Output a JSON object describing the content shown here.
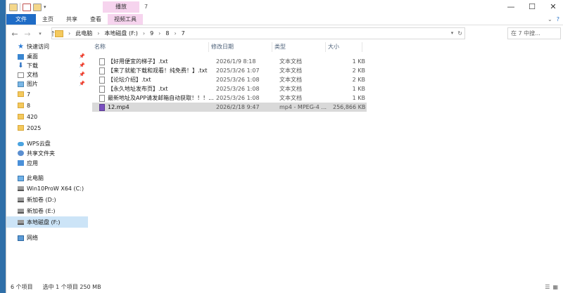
{
  "window": {
    "title": "7",
    "context_tab": "播放",
    "controls": {
      "minimize": "—",
      "maximize": "☐",
      "close": "✕"
    }
  },
  "ribbon": {
    "tabs": [
      "文件",
      "主页",
      "共享",
      "查看",
      "视频工具"
    ],
    "expand": "⌄",
    "help": "?"
  },
  "address": {
    "breadcrumbs": [
      "此电脑",
      "本地磁盘 (F:)",
      "9",
      "8",
      "7"
    ],
    "search_placeholder": "在 7 中搜..."
  },
  "nav": [
    {
      "label": "快速访问",
      "icon": "star-icon"
    },
    {
      "label": "桌面",
      "icon": "desktop-icon",
      "pinned": true
    },
    {
      "label": "下载",
      "icon": "download-icon",
      "pinned": true
    },
    {
      "label": "文档",
      "icon": "documents-icon",
      "pinned": true
    },
    {
      "label": "图片",
      "icon": "pictures-icon",
      "pinned": true
    },
    {
      "label": "7",
      "icon": "folder-icon"
    },
    {
      "label": "8",
      "icon": "folder-icon"
    },
    {
      "label": "420",
      "icon": "folder-icon"
    },
    {
      "label": "2025",
      "icon": "folder-icon"
    },
    {
      "label": "WPS云盘",
      "icon": "cloud-icon"
    },
    {
      "label": "共享文件夹",
      "icon": "share-icon"
    },
    {
      "label": "应用",
      "icon": "apps-icon"
    },
    {
      "label": "此电脑",
      "icon": "pc-icon"
    },
    {
      "label": "Win10ProW X64 (C:)",
      "icon": "drive-icon"
    },
    {
      "label": "新加卷 (D:)",
      "icon": "drive-icon"
    },
    {
      "label": "新加卷 (E:)",
      "icon": "drive-icon"
    },
    {
      "label": "本地磁盘 (F:)",
      "icon": "drive-icon",
      "selected": true
    },
    {
      "label": "网络",
      "icon": "network-icon"
    }
  ],
  "columns": [
    "名称",
    "修改日期",
    "类型",
    "大小"
  ],
  "files": [
    {
      "name": "【好用便宜的梯子】.txt",
      "date": "2026/1/9 8:18",
      "type": "文本文档",
      "size": "1 KB"
    },
    {
      "name": "【来了就能下载和观看！纯免费！】.txt",
      "date": "2025/3/26 1:07",
      "type": "文本文档",
      "size": "2 KB"
    },
    {
      "name": "【论坛介绍】.txt",
      "date": "2025/3/26 1:08",
      "type": "文本文档",
      "size": "2 KB"
    },
    {
      "name": "【永久地址发布页】.txt",
      "date": "2025/3/26 1:08",
      "type": "文本文档",
      "size": "1 KB"
    },
    {
      "name": "最新地址及APP请发邮箱自动获取！！！...",
      "date": "2025/3/26 1:08",
      "type": "文本文档",
      "size": "1 KB"
    },
    {
      "name": "12.mp4",
      "date": "2026/2/18 9:47",
      "type": "mp4 - MPEG-4 ...",
      "size": "256,866 KB",
      "selected": true
    }
  ],
  "status": {
    "count": "6 个项目",
    "selection": "选中 1 个项目  250 MB"
  }
}
